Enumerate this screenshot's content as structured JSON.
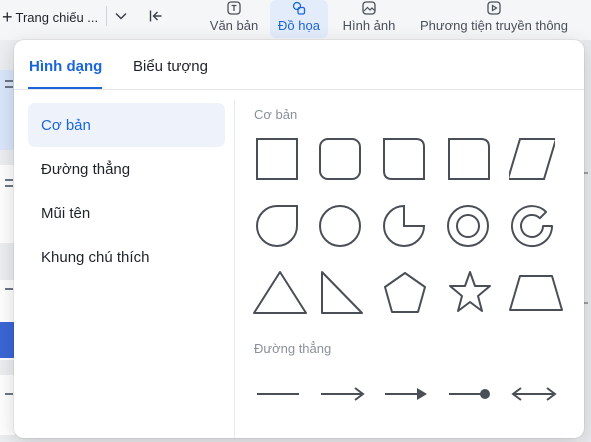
{
  "toolbar": {
    "slideshow_label": "Trang chiếu ...",
    "tabs": [
      {
        "label": "Văn bản",
        "icon": "text-icon"
      },
      {
        "label": "Đồ họa",
        "icon": "shapes-icon",
        "active": true
      },
      {
        "label": "Hình ảnh",
        "icon": "image-icon"
      },
      {
        "label": "Phương tiện truyền thông",
        "icon": "media-icon"
      }
    ]
  },
  "panel": {
    "tabs": [
      {
        "label": "Hình dạng",
        "active": true
      },
      {
        "label": "Biểu tượng"
      }
    ],
    "categories": [
      {
        "label": "Cơ bản",
        "active": true
      },
      {
        "label": "Đường thẳng"
      },
      {
        "label": "Mũi tên"
      },
      {
        "label": "Khung chú thích"
      }
    ],
    "sections": {
      "basic": "Cơ bản",
      "lines": "Đường thẳng"
    },
    "basic_shapes": [
      "rectangle",
      "rounded-rectangle",
      "snip-corner-rectangle",
      "round-corner-rectangle",
      "parallelogram",
      "teardrop",
      "circle",
      "pie",
      "donut",
      "block-arc",
      "triangle",
      "right-triangle",
      "pentagon",
      "star",
      "trapezoid"
    ],
    "line_shapes": [
      "line",
      "arrow-line",
      "filled-arrow-line",
      "dot-line",
      "double-arrow-line"
    ]
  },
  "colors": {
    "accent": "#1a66d9",
    "shape_stroke": "#4a4f57"
  }
}
